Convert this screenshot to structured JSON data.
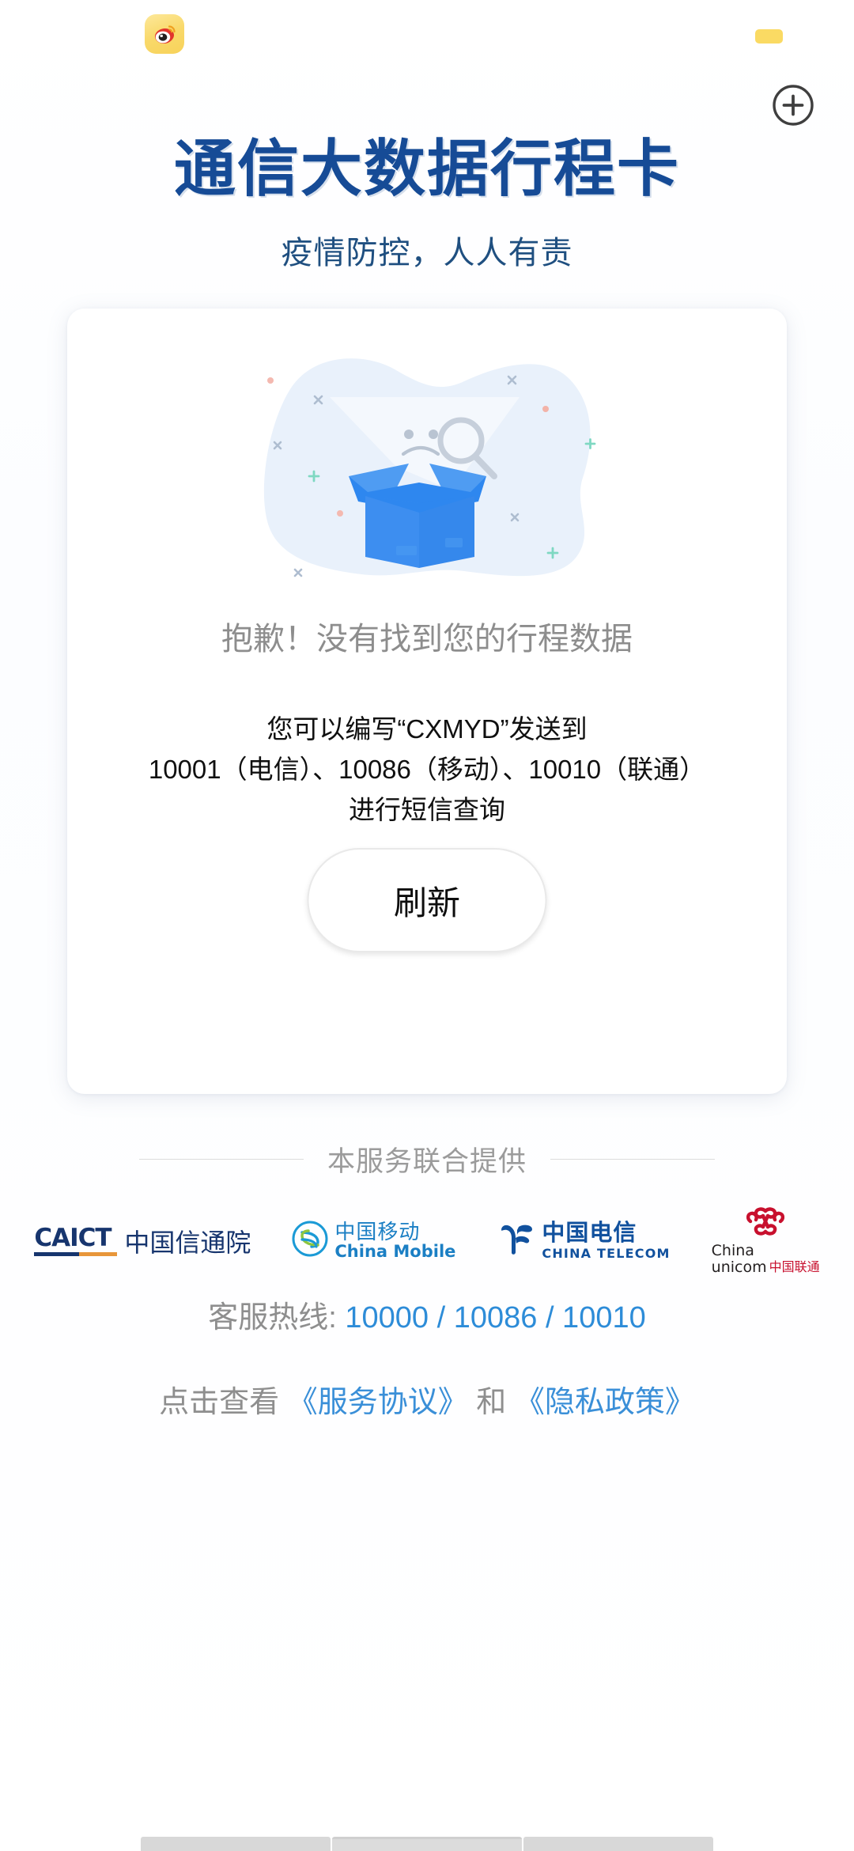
{
  "browser": {
    "app_icon": "weibo-icon",
    "chip": "yellow-chip",
    "add_button_icon": "plus-circle-icon"
  },
  "header": {
    "title": "通信大数据行程卡",
    "subtitle": "疫情防控，人人有责"
  },
  "card": {
    "illustration": "empty-box-sad-face-magnifier",
    "empty_message": "抱歉！没有找到您的行程数据",
    "hint_lines": [
      "您可以编写“CXMYD”发送到",
      "10001（电信）、10086（移动）、10010（联通）",
      "进行短信查询"
    ],
    "refresh_label": "刷新"
  },
  "providers": {
    "section_label": "本服务联合提供",
    "logos": [
      {
        "name": "caict",
        "abbr": "CAICT",
        "cn": "中国信通院"
      },
      {
        "name": "china-mobile",
        "cn": "中国移动",
        "en": "China Mobile"
      },
      {
        "name": "china-telecom",
        "cn": "中国电信",
        "en": "CHINA TELECOM"
      },
      {
        "name": "china-unicom",
        "en1": "China",
        "en2": "unicom",
        "cn": "中国联通"
      }
    ]
  },
  "footer": {
    "hotline_label": "客服热线:",
    "hotline_numbers": "10000 / 10086 / 10010",
    "agreement_prefix": "点击查看",
    "service_agreement": "《服务协议》",
    "agreement_conjunction": "和",
    "privacy_policy": "《隐私政策》"
  },
  "colors": {
    "title_blue": "#164b96",
    "subtitle_blue": "#1f4f80",
    "link_blue": "#3a8fd8",
    "muted_gray": "#8e8e8e",
    "box_blue": "#3d8ef0",
    "blob_blue": "#e8f0fb"
  }
}
